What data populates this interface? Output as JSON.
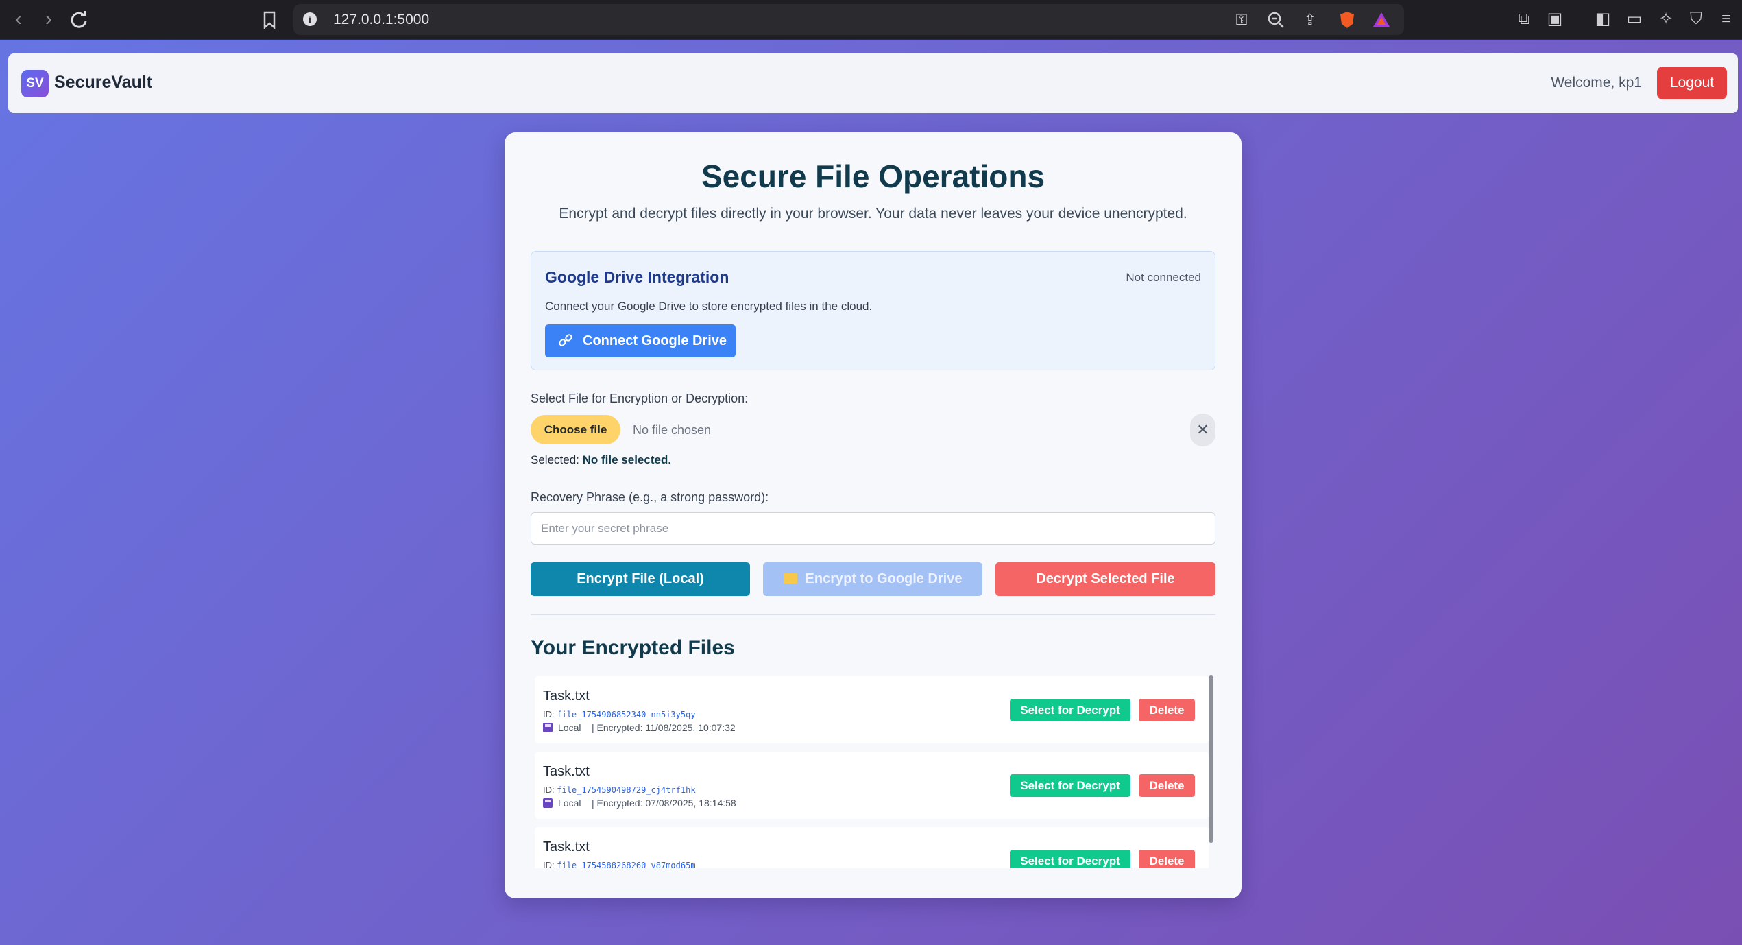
{
  "browser": {
    "url": "127.0.0.1:5000",
    "back_icon": "chevron-left-icon",
    "forward_icon": "chevron-right-icon",
    "reload_icon": "reload-icon"
  },
  "header": {
    "logo_text": "SV",
    "brand": "SecureVault",
    "welcome": "Welcome, kp1",
    "logout_label": "Logout"
  },
  "main": {
    "title": "Secure File Operations",
    "subtitle": "Encrypt and decrypt files directly in your browser. Your data never leaves your device unencrypted."
  },
  "gdrive": {
    "title": "Google Drive Integration",
    "status": "Not connected",
    "description": "Connect your Google Drive to store encrypted files in the cloud.",
    "connect_label": "Connect Google Drive"
  },
  "file_select": {
    "label": "Select File for Encryption or Decryption:",
    "choose_label": "Choose file",
    "no_file_text": "No file chosen",
    "clear_icon": "close-icon",
    "selected_prefix": "Selected:",
    "selected_value": "No file selected."
  },
  "phrase": {
    "label": "Recovery Phrase (e.g., a strong password):",
    "placeholder": "Enter your secret phrase",
    "value": ""
  },
  "actions": {
    "encrypt_local": "Encrypt File (Local)",
    "encrypt_drive": "Encrypt to Google Drive",
    "decrypt": "Decrypt Selected File"
  },
  "files": {
    "title": "Your Encrypted Files",
    "select_label": "Select for Decrypt",
    "delete_label": "Delete",
    "id_prefix": "ID:",
    "items": [
      {
        "name": "Task.txt",
        "id": "file_1754906852340_nn5i3y5qy",
        "location": "Local",
        "encrypted": "| Encrypted: 11/08/2025, 10:07:32"
      },
      {
        "name": "Task.txt",
        "id": "file_1754590498729_cj4trf1hk",
        "location": "Local",
        "encrypted": "| Encrypted: 07/08/2025, 18:14:58"
      },
      {
        "name": "Task.txt",
        "id": "file_1754588268260_v87mqd65m",
        "location": "",
        "encrypted": ""
      }
    ]
  },
  "colors": {
    "background_start": "#6675e3",
    "background_end": "#7a4fb3",
    "logout": "#e53e3e",
    "connect": "#3b82f6",
    "encrypt_local": "#0f86ac",
    "encrypt_drive": "#a3c1f5",
    "decrypt": "#f56565",
    "select_decrypt": "#10c98d"
  }
}
